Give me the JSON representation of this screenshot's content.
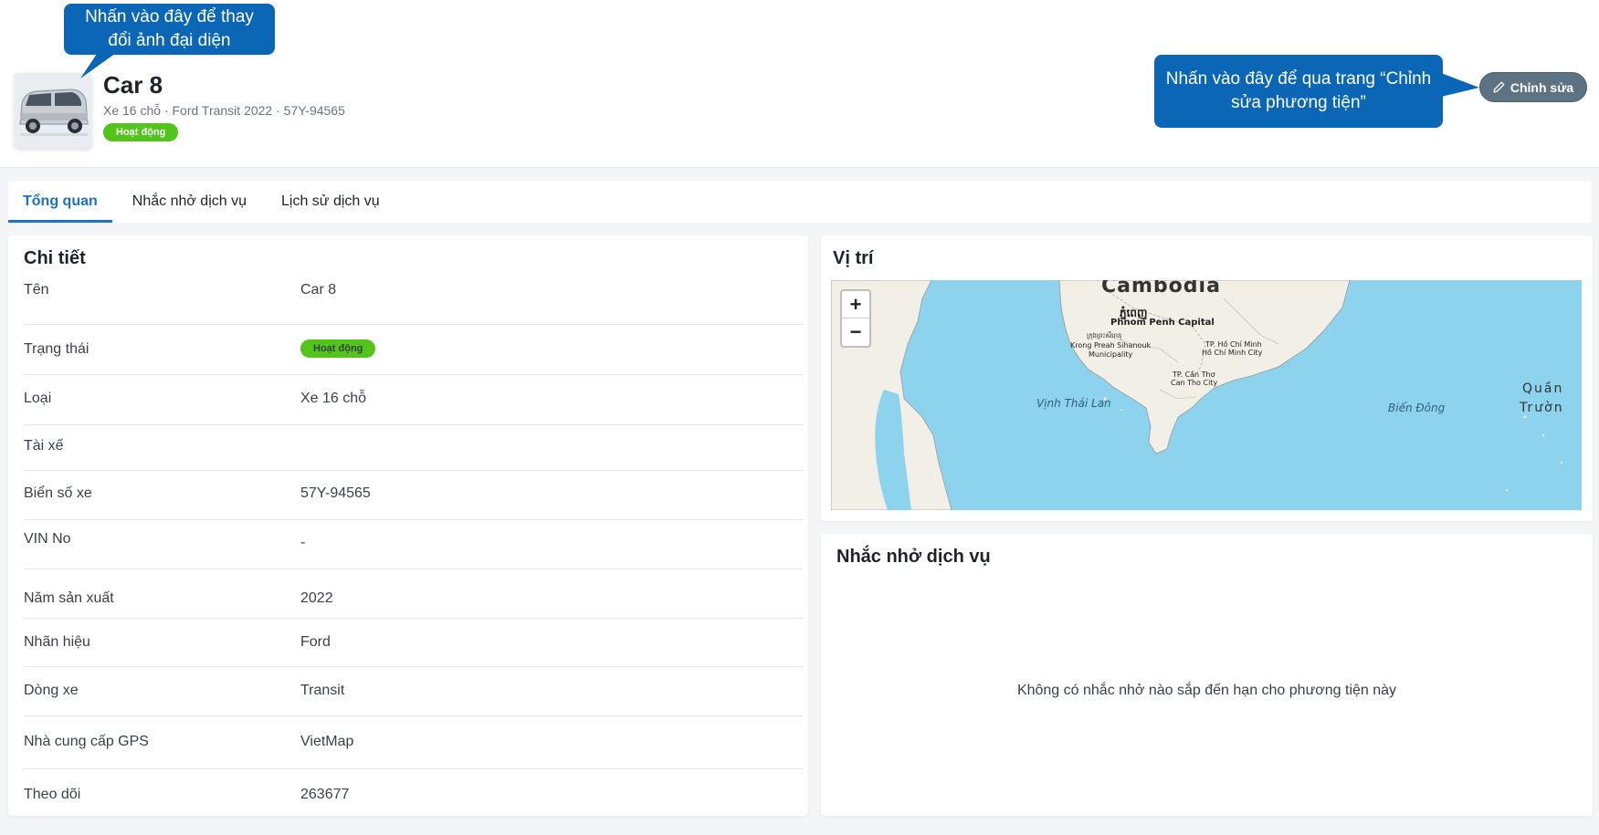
{
  "vehicle": {
    "name": "Car 8",
    "subtitle": "Xe 16 chỗ · Ford Transit 2022 · 57Y-94565",
    "status": "Hoạt động",
    "edit_label": "Chỉnh sửa"
  },
  "callouts": {
    "avatar": "Nhấn vào đây để thay đổi ảnh đại diện",
    "edit": "Nhấn vào đây để qua trang “Chỉnh sửa phương tiện”"
  },
  "tabs": [
    {
      "label": "Tổng quan",
      "active": true
    },
    {
      "label": "Nhắc nhở dịch vụ",
      "active": false
    },
    {
      "label": "Lịch sử dịch vụ",
      "active": false
    }
  ],
  "details": {
    "title": "Chi tiết",
    "rows": [
      {
        "label": "Tên",
        "value": "Car 8"
      },
      {
        "label": "Trạng thái",
        "value": "Hoạt động",
        "badge": true
      },
      {
        "label": "Loại",
        "value": "Xe 16 chỗ"
      },
      {
        "label": "Tài xế",
        "value": ""
      },
      {
        "label": "Biển số xe",
        "value": "57Y-94565"
      },
      {
        "label": "VIN No",
        "value": "-"
      },
      {
        "label": "Năm sản xuất",
        "value": "2022"
      },
      {
        "label": "Nhãn hiệu",
        "value": "Ford"
      },
      {
        "label": "Dòng xe",
        "value": "Transit"
      },
      {
        "label": "Nhà cung cấp GPS",
        "value": "VietMap"
      },
      {
        "label": "Theo dõi",
        "value": "263677"
      }
    ]
  },
  "location": {
    "title": "Vị trí",
    "zoom_in": "+",
    "zoom_out": "−",
    "labels": {
      "country": "Cambodia",
      "capital_km": "ភ្នំពេញ",
      "capital": "Phnom Penh Capital",
      "sihanouk_km": "ក្រុងព្រះសីហនុ",
      "sihanouk_1": "Krong Preah Sihanouk",
      "sihanouk_2": "Municipality",
      "hcm_1": "TP. Hồ Chí Minh",
      "hcm_2": "Hồ Chí Minh City",
      "cantho_1": "TP. Cần Thơ",
      "cantho_2": "Can Tho City",
      "gulf": "Vịnh Thái Lan",
      "east_sea": "Biển Đông",
      "island_1": "Quần",
      "island_2": "Trườn"
    }
  },
  "reminders": {
    "title": "Nhắc nhở dịch vụ",
    "empty": "Không có nhắc nhở nào sắp đến hạn cho phương tiện này"
  },
  "colors": {
    "accent": "#1a73c8",
    "status_green": "#52c41a",
    "callout_blue": "#0b67b6",
    "edit_button": "#5d7383"
  }
}
